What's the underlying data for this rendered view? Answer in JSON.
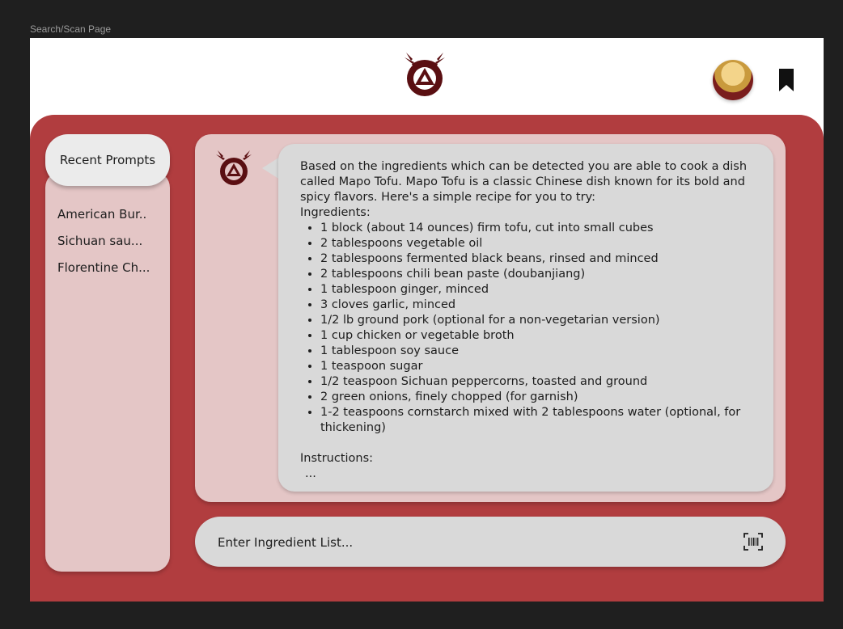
{
  "frame_label": "Search/Scan Page",
  "sidebar": {
    "recent_label": "Recent Prompts",
    "items": [
      "American Bur..",
      "Sichuan sau...",
      "Florentine Ch..."
    ]
  },
  "chat": {
    "intro": "Based on the ingredients which can be detected you are able to cook a dish called Mapo Tofu. Mapo Tofu is a classic Chinese dish known for its bold and spicy flavors. Here's a simple recipe for you to try:",
    "ingredients_label": "Ingredients:",
    "ingredients": [
      "1 block (about 14 ounces) firm tofu, cut into small cubes",
      "2 tablespoons vegetable oil",
      "2 tablespoons fermented black beans, rinsed and minced",
      "2 tablespoons chili bean paste (doubanjiang)",
      "1 tablespoon ginger, minced",
      "3 cloves garlic, minced",
      "1/2 lb ground pork (optional for a non-vegetarian version)",
      "1 cup chicken or vegetable broth",
      "1 tablespoon soy sauce",
      "1 teaspoon sugar",
      "1/2 teaspoon Sichuan peppercorns, toasted and ground",
      "2 green onions, finely chopped (for garnish)",
      "1-2 teaspoons cornstarch mixed with 2 tablespoons water (optional, for thickening)"
    ],
    "instructions_label": "Instructions:",
    "instructions_ellipsis": "..."
  },
  "input": {
    "placeholder": "Enter Ingredient List..."
  },
  "icons": {
    "logo": "ouroboros-logo",
    "bookmark": "bookmark-icon",
    "scan": "barcode-scan-icon"
  },
  "colors": {
    "main_bg": "#b13d3f",
    "panel_bg": "#e4c6c6",
    "bubble_bg": "#d9d9d9",
    "logo": "#5a0f12"
  }
}
